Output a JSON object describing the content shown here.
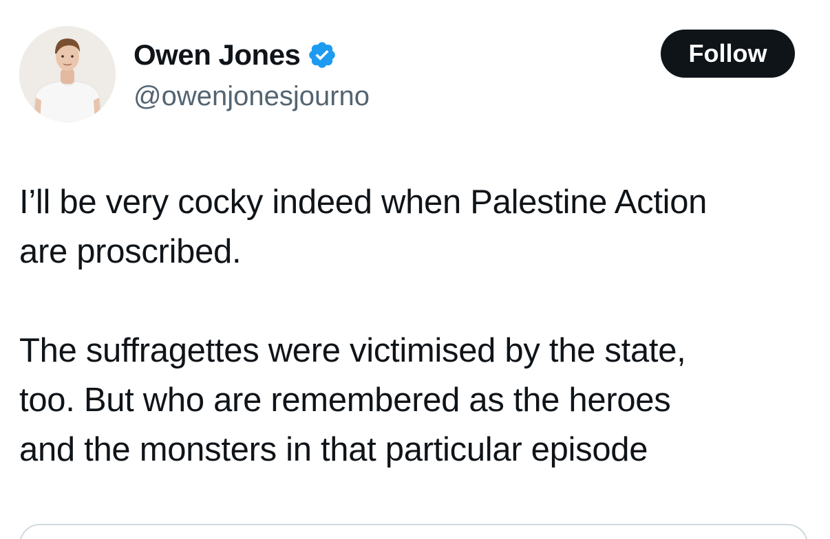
{
  "author": {
    "display_name": "Owen Jones",
    "handle": "@owenjonesjourno",
    "verified": true,
    "avatar_icon": "profile-photo"
  },
  "follow_button": {
    "label": "Follow"
  },
  "tweet": {
    "paragraphs": [
      "I’ll be very cocky indeed when Palestine Action\nare proscribed.",
      "The suffragettes were victimised by the state,\ntoo. But who are remembered as the heroes\nand the monsters in that particular episode"
    ]
  },
  "colors": {
    "text_primary": "#0f1419",
    "text_secondary": "#536471",
    "verified_blue": "#1d9bf0",
    "button_bg": "#0f1419",
    "button_text": "#ffffff",
    "border": "#cfd9de"
  }
}
